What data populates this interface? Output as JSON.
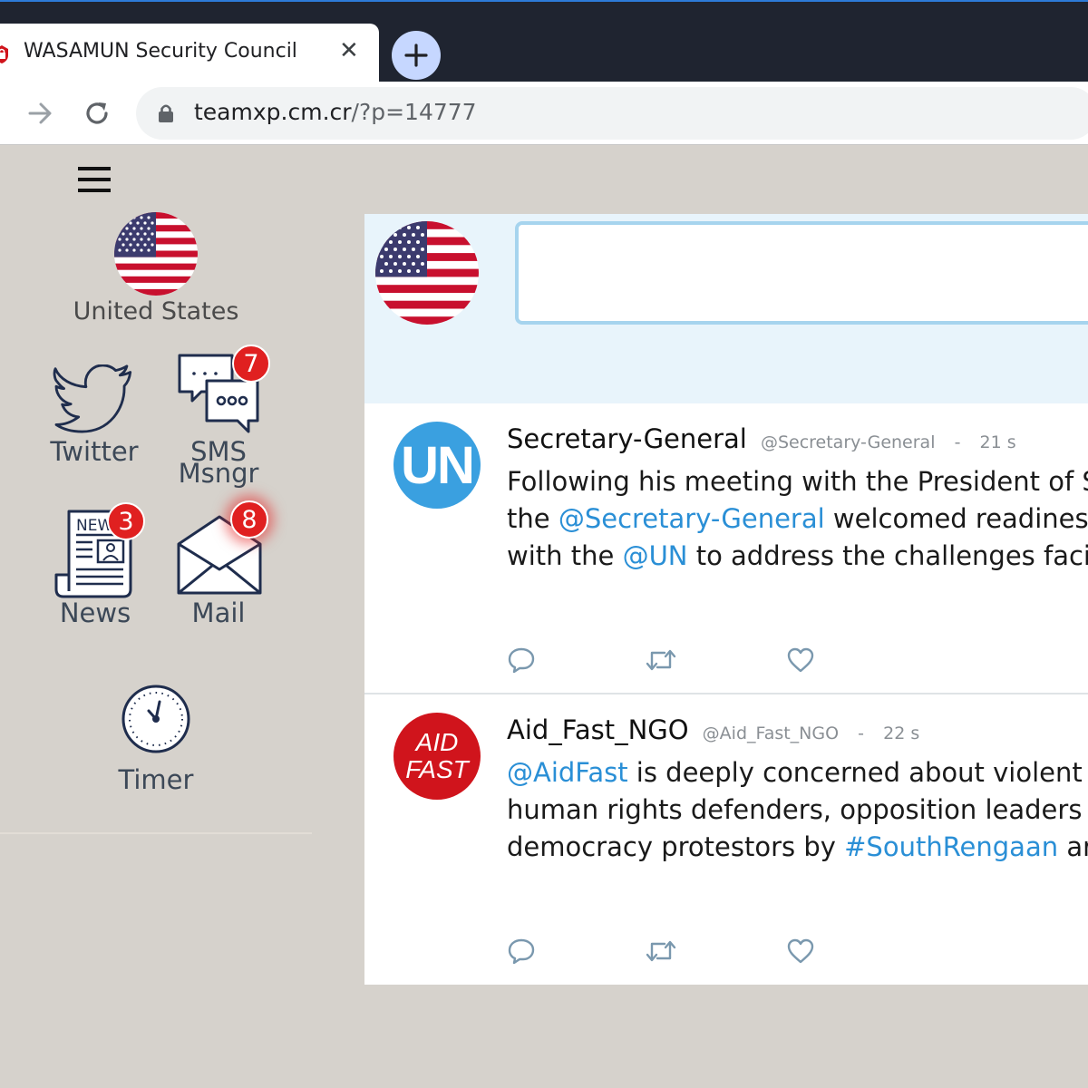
{
  "browser": {
    "tab_title": "WASAMUN Security Council",
    "tab_close": "✕",
    "url_host": "teamxp.cm.cr",
    "url_path": "/?p=14777"
  },
  "sidebar": {
    "country": "United States",
    "apps": [
      {
        "label": "Twitter"
      },
      {
        "label_line1": "SMS",
        "label_line2": "Msngr",
        "badge": "7"
      },
      {
        "label": "News",
        "badge": "3",
        "icon_text": "NEW"
      },
      {
        "label": "Mail",
        "badge": "8"
      },
      {
        "label": "Timer"
      }
    ]
  },
  "tweets": [
    {
      "name": "Secretary-General",
      "handle": "@Secretary-General",
      "sep": "-",
      "time": "21 s",
      "avatar_text": "UN",
      "avatar_color": "#3aa0e0",
      "lines": [
        [
          {
            "t": "Following his meeting with the President of So",
            "m": false
          }
        ],
        [
          {
            "t": "the ",
            "m": false
          },
          {
            "t": "@Secretary-General",
            "m": true
          },
          {
            "t": " welcomed readiness",
            "m": false
          }
        ],
        [
          {
            "t": "with the ",
            "m": false
          },
          {
            "t": "@UN",
            "m": true
          },
          {
            "t": " to address the challenges facin",
            "m": false
          }
        ]
      ]
    },
    {
      "name": "Aid_Fast_NGO",
      "handle": "@Aid_Fast_NGO",
      "sep": "-",
      "time": "22 s",
      "avatar_line1": "AID",
      "avatar_line2": "FAST",
      "avatar_color": "#d0141c",
      "lines": [
        [
          {
            "t": "@AidFast",
            "m": true
          },
          {
            "t": " is deeply concerned about violent c",
            "m": false
          }
        ],
        [
          {
            "t": "human rights defenders, opposition leaders &",
            "m": false
          }
        ],
        [
          {
            "t": "democracy protestors by ",
            "m": false
          },
          {
            "t": "#SouthRengaan",
            "m": true
          },
          {
            "t": " arm",
            "m": false
          }
        ]
      ]
    }
  ],
  "colors": {
    "mention": "#2a8fd6",
    "badge": "#e02020",
    "composer_bg": "#e8f4fb",
    "composer_border": "#a6d4ee",
    "icon_stroke": "#1f2d4d",
    "action_icon": "#7a98ae"
  },
  "icons": [
    "new-tab-plus-icon",
    "forward-arrow-icon",
    "reload-icon",
    "lock-icon",
    "hamburger-menu-icon",
    "twitter-bird-icon",
    "chat-bubbles-icon",
    "newspaper-icon",
    "envelope-icon",
    "clock-timer-icon",
    "reply-icon",
    "retweet-icon",
    "like-heart-icon"
  ]
}
